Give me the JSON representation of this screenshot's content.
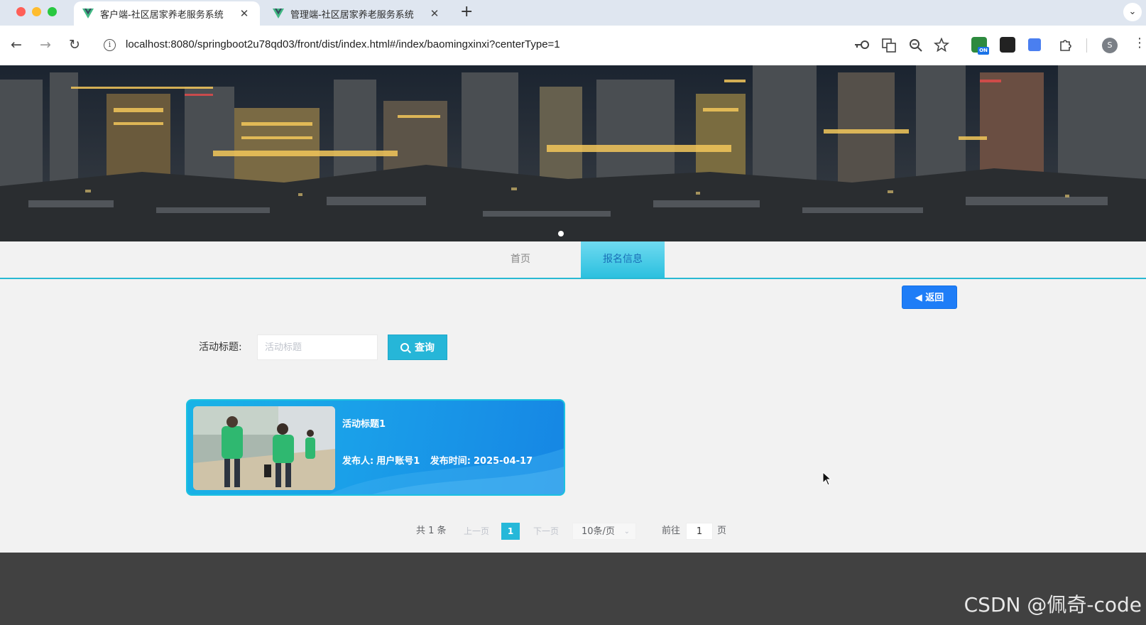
{
  "browser": {
    "tabs": [
      {
        "title": "客户端-社区居家养老服务系统",
        "active": true
      },
      {
        "title": "管理端-社区居家养老服务系统",
        "active": false
      }
    ],
    "new_tab_label": "+",
    "tab_menu_label": "⌄",
    "url": "localhost:8080/springboot2u78qd03/front/dist/index.html#/index/baomingxinxi?centerType=1",
    "profile_initial": "S"
  },
  "nav": {
    "items": [
      {
        "label": "首页",
        "active": false
      },
      {
        "label": "报名信息",
        "active": true
      }
    ]
  },
  "back_button": {
    "label": "返回"
  },
  "search": {
    "label": "活动标题:",
    "placeholder": "活动标题",
    "button_label": "查询"
  },
  "cards": [
    {
      "title": "活动标题1",
      "publisher_label": "发布人:",
      "publisher": "用户账号1",
      "time_label": "发布时间:",
      "time": "2025-04-17"
    }
  ],
  "pagination": {
    "total": "共 1 条",
    "prev": "上一页",
    "current": "1",
    "next": "下一页",
    "page_size": "10条/页",
    "goto_label": "前往",
    "goto_value": "1",
    "goto_unit": "页"
  },
  "watermark": "CSDN @佩奇-code",
  "colors": {
    "accent": "#25b8d9",
    "back_button": "#1e7df7",
    "card_gradient_start": "#19b3e6",
    "card_gradient_end": "#1686e4",
    "footer": "#414141"
  }
}
